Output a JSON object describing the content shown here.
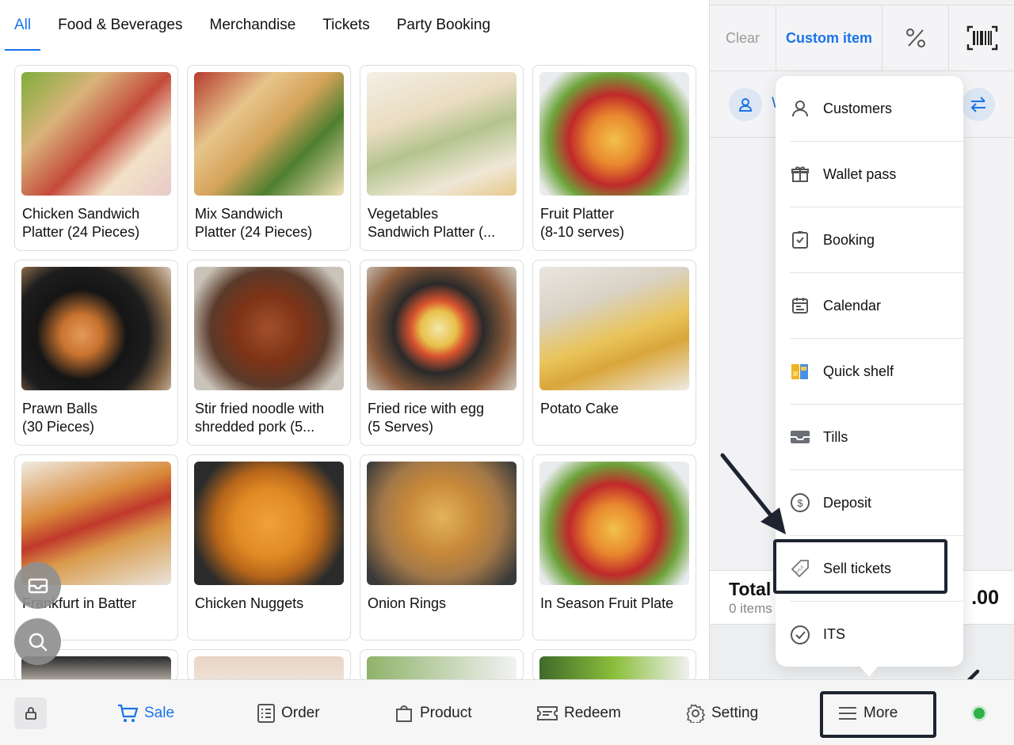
{
  "tabs": [
    "All",
    "Food & Beverages",
    "Merchandise",
    "Tickets",
    "Party Booking"
  ],
  "products": [
    {
      "name": "Chicken Sandwich Platter (24 Pieces)",
      "line1": "Chicken Sandwich",
      "line2": "Platter (24 Pieces)"
    },
    {
      "name": "Mix Sandwich Platter (24 Pieces)",
      "line1": "Mix Sandwich",
      "line2": "Platter (24 Pieces)"
    },
    {
      "name": "Vegetables Sandwich Platter (...",
      "line1": "Vegetables",
      "line2": "Sandwich Platter (..."
    },
    {
      "name": "Fruit Platter (8-10 serves)",
      "line1": "Fruit Platter",
      "line2": "(8-10 serves)"
    },
    {
      "name": "Prawn Balls (30 Pieces)",
      "line1": "Prawn Balls",
      "line2": "(30 Pieces)"
    },
    {
      "name": "Stir fried noodle with shredded pork (5...",
      "line1": "Stir fried noodle with",
      "line2": "shredded pork (5..."
    },
    {
      "name": "Fried rice with egg (5 Serves)",
      "line1": "Fried rice with egg",
      "line2": "(5 Serves)"
    },
    {
      "name": "Potato Cake",
      "line1": "Potato Cake",
      "line2": ""
    },
    {
      "name": "Frankfurt in Batter",
      "line1": "Frankfurt in Batter",
      "line2": ""
    },
    {
      "name": "Chicken Nuggets",
      "line1": "Chicken Nuggets",
      "line2": ""
    },
    {
      "name": "Onion Rings",
      "line1": "Onion Rings",
      "line2": ""
    },
    {
      "name": "In Season Fruit Plate",
      "line1": "In Season Fruit Plate",
      "line2": ""
    }
  ],
  "right_panel": {
    "clear_label": "Clear",
    "custom_item_label": "Custom item",
    "customer_initial": "W",
    "total_label": "Total",
    "items_count": "0 items",
    "total_amount": ".00"
  },
  "menu": {
    "items": [
      {
        "label": "Customers",
        "icon": "person-icon"
      },
      {
        "label": "Wallet pass",
        "icon": "gift-icon"
      },
      {
        "label": "Booking",
        "icon": "clipboard-check-icon"
      },
      {
        "label": "Calendar",
        "icon": "calendar-icon"
      },
      {
        "label": "Quick shelf",
        "icon": "shelf-icon"
      },
      {
        "label": "Tills",
        "icon": "tray-icon"
      },
      {
        "label": "Deposit",
        "icon": "dollar-circle-icon"
      },
      {
        "label": "Sell tickets",
        "icon": "ticket-tag-icon"
      },
      {
        "label": "ITS",
        "icon": "check-circle-icon"
      }
    ]
  },
  "bottom_nav": {
    "sale": "Sale",
    "order": "Order",
    "product": "Product",
    "redeem": "Redeem",
    "setting": "Setting",
    "more": "More"
  },
  "colors": {
    "accent": "#1a73e8",
    "status": "#2fb14a",
    "annotation": "#1d2430"
  }
}
